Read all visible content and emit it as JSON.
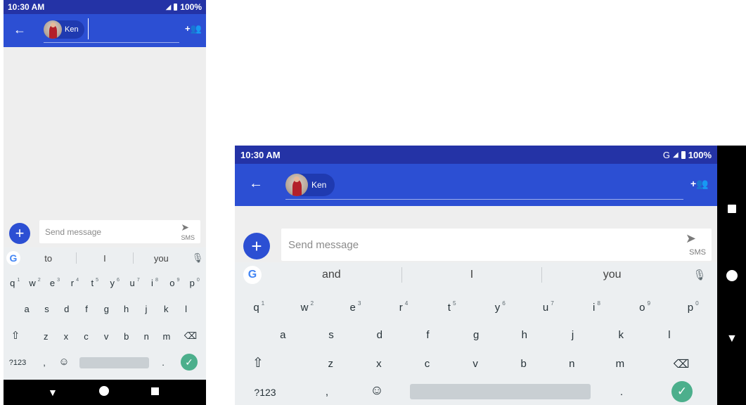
{
  "status": {
    "time": "10:30 AM",
    "battery": "100%",
    "network": "G"
  },
  "appbar": {
    "contact_name": "Ken"
  },
  "composer": {
    "placeholder": "Send message",
    "send_label": "SMS"
  },
  "left": {
    "suggestions": [
      "to",
      "I",
      "you"
    ],
    "row1": [
      {
        "k": "q",
        "n": "1"
      },
      {
        "k": "w",
        "n": "2"
      },
      {
        "k": "e",
        "n": "3"
      },
      {
        "k": "r",
        "n": "4"
      },
      {
        "k": "t",
        "n": "5"
      },
      {
        "k": "y",
        "n": "6"
      },
      {
        "k": "u",
        "n": "7"
      },
      {
        "k": "i",
        "n": "8"
      },
      {
        "k": "o",
        "n": "9"
      },
      {
        "k": "p",
        "n": "0"
      }
    ],
    "row2": [
      "a",
      "s",
      "d",
      "f",
      "g",
      "h",
      "j",
      "k",
      "l"
    ],
    "row3": [
      "z",
      "x",
      "c",
      "v",
      "b",
      "n",
      "m"
    ],
    "symbols_key": "?123",
    "comma_key": ",",
    "period_key": "."
  },
  "right": {
    "suggestions": [
      "and",
      "I",
      "you"
    ],
    "row1": [
      {
        "k": "q",
        "n": "1"
      },
      {
        "k": "w",
        "n": "2"
      },
      {
        "k": "e",
        "n": "3"
      },
      {
        "k": "r",
        "n": "4"
      },
      {
        "k": "t",
        "n": "5"
      },
      {
        "k": "y",
        "n": "6"
      },
      {
        "k": "u",
        "n": "7"
      },
      {
        "k": "i",
        "n": "8"
      },
      {
        "k": "o",
        "n": "9"
      },
      {
        "k": "p",
        "n": "0"
      }
    ],
    "row2": [
      "a",
      "s",
      "d",
      "f",
      "g",
      "h",
      "j",
      "k",
      "l"
    ],
    "row3": [
      "z",
      "x",
      "c",
      "v",
      "b",
      "n",
      "m"
    ],
    "symbols_key": "?123",
    "comma_key": ",",
    "period_key": "."
  },
  "colors": {
    "appbar": "#2c4fd3",
    "status": "#2433a6",
    "fab": "#2c4fd3",
    "check": "#4caf8c",
    "keyboard": "#eceff1"
  }
}
